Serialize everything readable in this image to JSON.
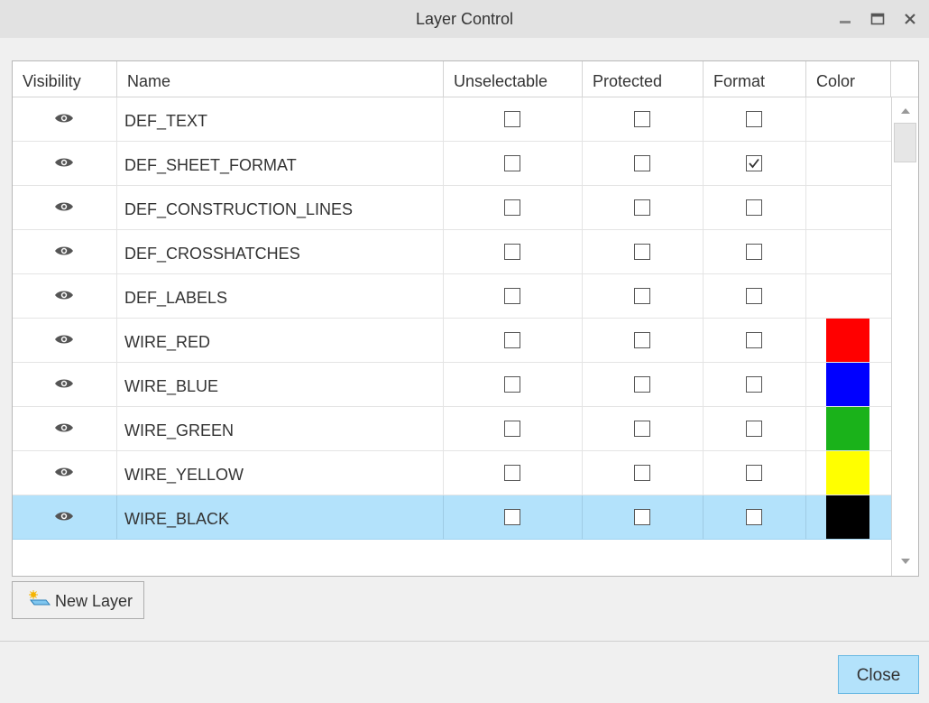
{
  "window": {
    "title": "Layer Control",
    "controls": [
      "minimize-icon",
      "maximize-icon",
      "close-icon"
    ]
  },
  "table": {
    "columns": [
      "Visibility",
      "Name",
      "Unselectable",
      "Protected",
      "Format",
      "Color"
    ],
    "rows": [
      {
        "name": "DEF_TEXT",
        "visible": true,
        "unselectable": false,
        "protected": false,
        "format": false,
        "color": null,
        "selected": false
      },
      {
        "name": "DEF_SHEET_FORMAT",
        "visible": true,
        "unselectable": false,
        "protected": false,
        "format": true,
        "color": null,
        "selected": false
      },
      {
        "name": "DEF_CONSTRUCTION_LINES",
        "visible": true,
        "unselectable": false,
        "protected": false,
        "format": false,
        "color": null,
        "selected": false
      },
      {
        "name": "DEF_CROSSHATCHES",
        "visible": true,
        "unselectable": false,
        "protected": false,
        "format": false,
        "color": null,
        "selected": false
      },
      {
        "name": "DEF_LABELS",
        "visible": true,
        "unselectable": false,
        "protected": false,
        "format": false,
        "color": null,
        "selected": false
      },
      {
        "name": "WIRE_RED",
        "visible": true,
        "unselectable": false,
        "protected": false,
        "format": false,
        "color": "#ff0000",
        "selected": false
      },
      {
        "name": "WIRE_BLUE",
        "visible": true,
        "unselectable": false,
        "protected": false,
        "format": false,
        "color": "#0000ff",
        "selected": false
      },
      {
        "name": "WIRE_GREEN",
        "visible": true,
        "unselectable": false,
        "protected": false,
        "format": false,
        "color": "#1ab21a",
        "selected": false
      },
      {
        "name": "WIRE_YELLOW",
        "visible": true,
        "unselectable": false,
        "protected": false,
        "format": false,
        "color": "#ffff00",
        "selected": false
      },
      {
        "name": "WIRE_BLACK",
        "visible": true,
        "unselectable": false,
        "protected": false,
        "format": false,
        "color": "#000000",
        "selected": true
      }
    ]
  },
  "actions": {
    "new_layer_label": "New Layer",
    "close_label": "Close"
  },
  "colors": {
    "selection": "#b3e2fb",
    "titlebar": "#e2e2e2",
    "background": "#f0f0f0"
  }
}
